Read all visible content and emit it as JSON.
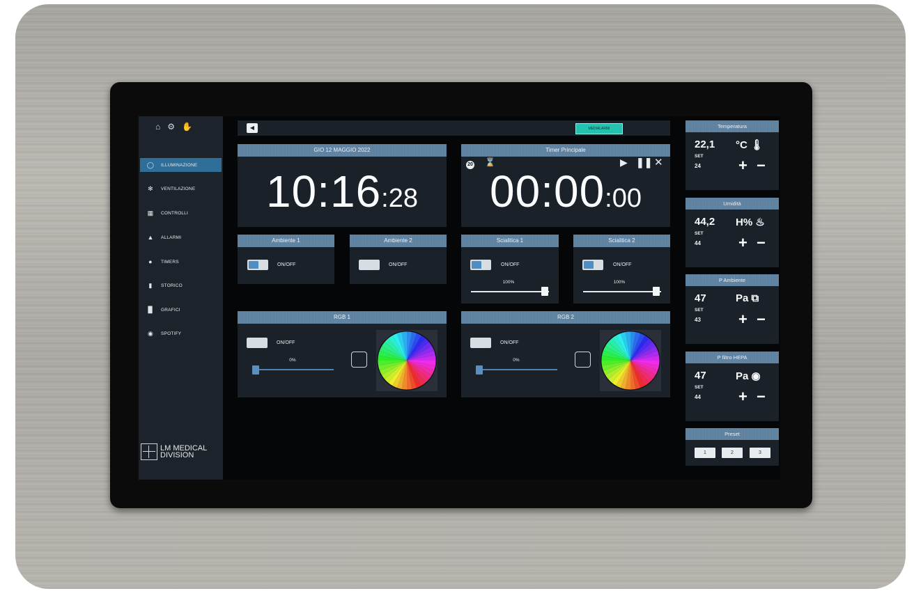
{
  "sidebar": {
    "top_icons": [
      "home-icon",
      "gears-icon",
      "hand-icon"
    ],
    "items": [
      {
        "label": "ILLUMINAZIONE",
        "icon": "bulb-icon",
        "active": true
      },
      {
        "label": "VENTILAZIONE",
        "icon": "fan-icon",
        "active": false
      },
      {
        "label": "CONTROLLI",
        "icon": "controls-icon",
        "active": false
      },
      {
        "label": "ALLARMI",
        "icon": "warning-icon",
        "active": false
      },
      {
        "label": "TIMERS",
        "icon": "clock-icon",
        "active": false
      },
      {
        "label": "STORICO",
        "icon": "history-icon",
        "active": false
      },
      {
        "label": "GRAFICI",
        "icon": "chart-icon",
        "active": false
      },
      {
        "label": "SPOTIFY",
        "icon": "spotify-icon",
        "active": false
      }
    ],
    "logo_line1": "LM MEDICAL",
    "logo_line2": "DIVISION"
  },
  "topbar": {
    "speaker_icon": "speaker-icon",
    "badge_label": "MEDIALARMI"
  },
  "clock": {
    "date": "GIO 12 MAGGIO 2022",
    "hhmm": "10:16",
    "sec": ":28"
  },
  "timer": {
    "title": "Timer Principale",
    "badge": "20",
    "hhmm": "00:00",
    "sec": ":00"
  },
  "lights": [
    {
      "title": "Ambiente 1",
      "toggle_label": "ON/OFF"
    },
    {
      "title": "Ambiente 2",
      "toggle_label": "ON/OFF"
    },
    {
      "title": "Scialitica 1",
      "toggle_label": "ON/OFF",
      "level": "100%"
    },
    {
      "title": "Scialitica 2",
      "toggle_label": "ON/OFF",
      "level": "100%"
    }
  ],
  "rgb": [
    {
      "title": "RGB 1",
      "toggle_label": "ON/OFF",
      "level": "0%"
    },
    {
      "title": "RGB 2",
      "toggle_label": "ON/OFF",
      "level": "0%"
    }
  ],
  "sensors": [
    {
      "title": "Temperatura",
      "value": "22,1",
      "unit": "°C",
      "icon": "thermometer-icon",
      "set_label": "SET",
      "set_value": "24"
    },
    {
      "title": "Umidità",
      "value": "44,2",
      "unit": "H%",
      "icon": "drop-icon",
      "set_label": "SET",
      "set_value": "44"
    },
    {
      "title": "P Ambiente",
      "value": "47",
      "unit": "Pa",
      "icon": "export-icon",
      "set_label": "SET",
      "set_value": "43"
    },
    {
      "title": "P filtro HEPA",
      "value": "47",
      "unit": "Pa",
      "icon": "filter-icon",
      "set_label": "SET",
      "set_value": "44"
    }
  ],
  "preset": {
    "title": "Preset",
    "buttons": [
      "1",
      "2",
      "3"
    ]
  },
  "symbols": {
    "plus": "+",
    "minus": "−",
    "toggle_on_text": "ON"
  }
}
